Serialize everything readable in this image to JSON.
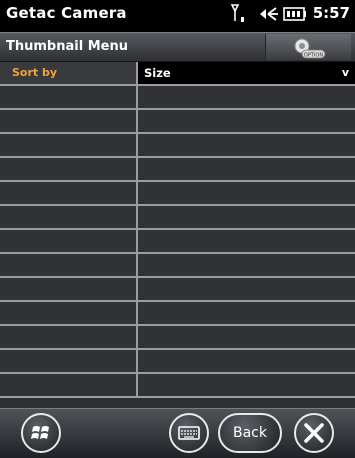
{
  "status_bar": {
    "app_title": "Getac Camera",
    "time": "5:57",
    "icons": [
      "signal-icon",
      "volume-icon",
      "battery-icon"
    ]
  },
  "menu_bar": {
    "title": "Thumbnail Menu",
    "option_label": "OPTION"
  },
  "sort": {
    "label": "Sort by",
    "value": "Size",
    "dropdown_indicator": "v"
  },
  "bottom_bar": {
    "back_label": "Back",
    "icons": [
      "windows-icon",
      "keyboard-icon",
      "close-icon"
    ]
  },
  "colors": {
    "sort_label": "#f2a23a",
    "background": "#000000"
  }
}
